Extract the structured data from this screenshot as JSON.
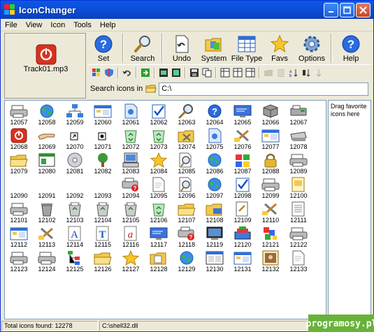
{
  "window": {
    "title": "IconChanger"
  },
  "colors": {
    "titlebar": "#0a5ae6",
    "close": "#d1512f",
    "watermark_bg": "#68b23a"
  },
  "menu": [
    "File",
    "View",
    "Icon",
    "Tools",
    "Help"
  ],
  "preview": {
    "filename": "Track01.mp3",
    "icon": "power-icon"
  },
  "toolbar": {
    "set": "Set",
    "search": "Search",
    "undo": "Undo",
    "system": "System",
    "filetype": "File Type",
    "favs": "Favs",
    "options": "Options",
    "help": "Help"
  },
  "search": {
    "label": "Search icons in",
    "path": "C:\\"
  },
  "icons": [
    {
      "n": "12057",
      "i": "printer"
    },
    {
      "n": "12058",
      "i": "globe"
    },
    {
      "n": "12059",
      "i": "network"
    },
    {
      "n": "12060",
      "i": "window"
    },
    {
      "n": "12061",
      "i": "doc-blue"
    },
    {
      "n": "12062",
      "i": "check-doc"
    },
    {
      "n": "12063",
      "i": "search"
    },
    {
      "n": "12064",
      "i": "help"
    },
    {
      "n": "12065",
      "i": "monitor-blue"
    },
    {
      "n": "12066",
      "i": "drive"
    },
    {
      "n": "12067",
      "i": "fax"
    },
    {
      "n": "12068",
      "i": "power"
    },
    {
      "n": "12069",
      "i": "hand"
    },
    {
      "n": "12070",
      "i": "shortcut"
    },
    {
      "n": "12071",
      "i": "shortcut-black"
    },
    {
      "n": "12072",
      "i": "recycle"
    },
    {
      "n": "12073",
      "i": "recycle"
    },
    {
      "n": "12074",
      "i": "folder-tools"
    },
    {
      "n": "12075",
      "i": "doc-blue"
    },
    {
      "n": "12076",
      "i": "tools"
    },
    {
      "n": "12077",
      "i": "window"
    },
    {
      "n": "12078",
      "i": "scanner"
    },
    {
      "n": "12079",
      "i": "folder"
    },
    {
      "n": "12080",
      "i": "green-window"
    },
    {
      "n": "12081",
      "i": "cd"
    },
    {
      "n": "12082",
      "i": "tree"
    },
    {
      "n": "12083",
      "i": "computer"
    },
    {
      "n": "12084",
      "i": "star"
    },
    {
      "n": "12085",
      "i": "search-doc"
    },
    {
      "n": "12086",
      "i": "globe"
    },
    {
      "n": "12087",
      "i": "windows"
    },
    {
      "n": "12088",
      "i": "lock"
    },
    {
      "n": "12089",
      "i": "printer"
    },
    {
      "n": "12090",
      "i": "blank"
    },
    {
      "n": "12091",
      "i": "blank"
    },
    {
      "n": "12092",
      "i": "blank"
    },
    {
      "n": "12093",
      "i": "blank"
    },
    {
      "n": "12094",
      "i": "printer-error"
    },
    {
      "n": "12095",
      "i": "doc-white"
    },
    {
      "n": "12096",
      "i": "search-doc"
    },
    {
      "n": "12097",
      "i": "globe"
    },
    {
      "n": "12098",
      "i": "check-doc"
    },
    {
      "n": "12099",
      "i": "printer"
    },
    {
      "n": "12100",
      "i": "doc-yellow"
    },
    {
      "n": "12101",
      "i": "printer"
    },
    {
      "n": "12102",
      "i": "trash"
    },
    {
      "n": "12103",
      "i": "recycle-full"
    },
    {
      "n": "12104",
      "i": "recycle-full"
    },
    {
      "n": "12105",
      "i": "recycle-full"
    },
    {
      "n": "12106",
      "i": "recycle"
    },
    {
      "n": "12107",
      "i": "folder"
    },
    {
      "n": "12108",
      "i": "folder-blue"
    },
    {
      "n": "12109",
      "i": "doc-tools"
    },
    {
      "n": "12110",
      "i": "tools"
    },
    {
      "n": "12111",
      "i": "doc-lines"
    },
    {
      "n": "12112",
      "i": "window"
    },
    {
      "n": "12113",
      "i": "tools"
    },
    {
      "n": "12114",
      "i": "font-a"
    },
    {
      "n": "12115",
      "i": "font-t"
    },
    {
      "n": "12116",
      "i": "font-a-red"
    },
    {
      "n": "12117",
      "i": "monitor-blue"
    },
    {
      "n": "12118",
      "i": "printer-error"
    },
    {
      "n": "12119",
      "i": "monitor"
    },
    {
      "n": "12120",
      "i": "books"
    },
    {
      "n": "12121",
      "i": "blocks"
    },
    {
      "n": "12122",
      "i": "printer"
    },
    {
      "n": "12123",
      "i": "printer"
    },
    {
      "n": "12124",
      "i": "printer"
    },
    {
      "n": "12125",
      "i": "network-tree"
    },
    {
      "n": "12126",
      "i": "folder"
    },
    {
      "n": "12127",
      "i": "star"
    },
    {
      "n": "12128",
      "i": "folder-doc"
    },
    {
      "n": "12129",
      "i": "globe"
    },
    {
      "n": "12130",
      "i": "screen"
    },
    {
      "n": "12131",
      "i": "window"
    },
    {
      "n": "12132",
      "i": "picture"
    },
    {
      "n": "12133",
      "i": "doc-white"
    }
  ],
  "favorites": {
    "hint": "Drag favorite icons here"
  },
  "status": {
    "total": "Total icons found: 12278",
    "file": "C:\\shell32.dll"
  },
  "watermark": "programosy.pl"
}
